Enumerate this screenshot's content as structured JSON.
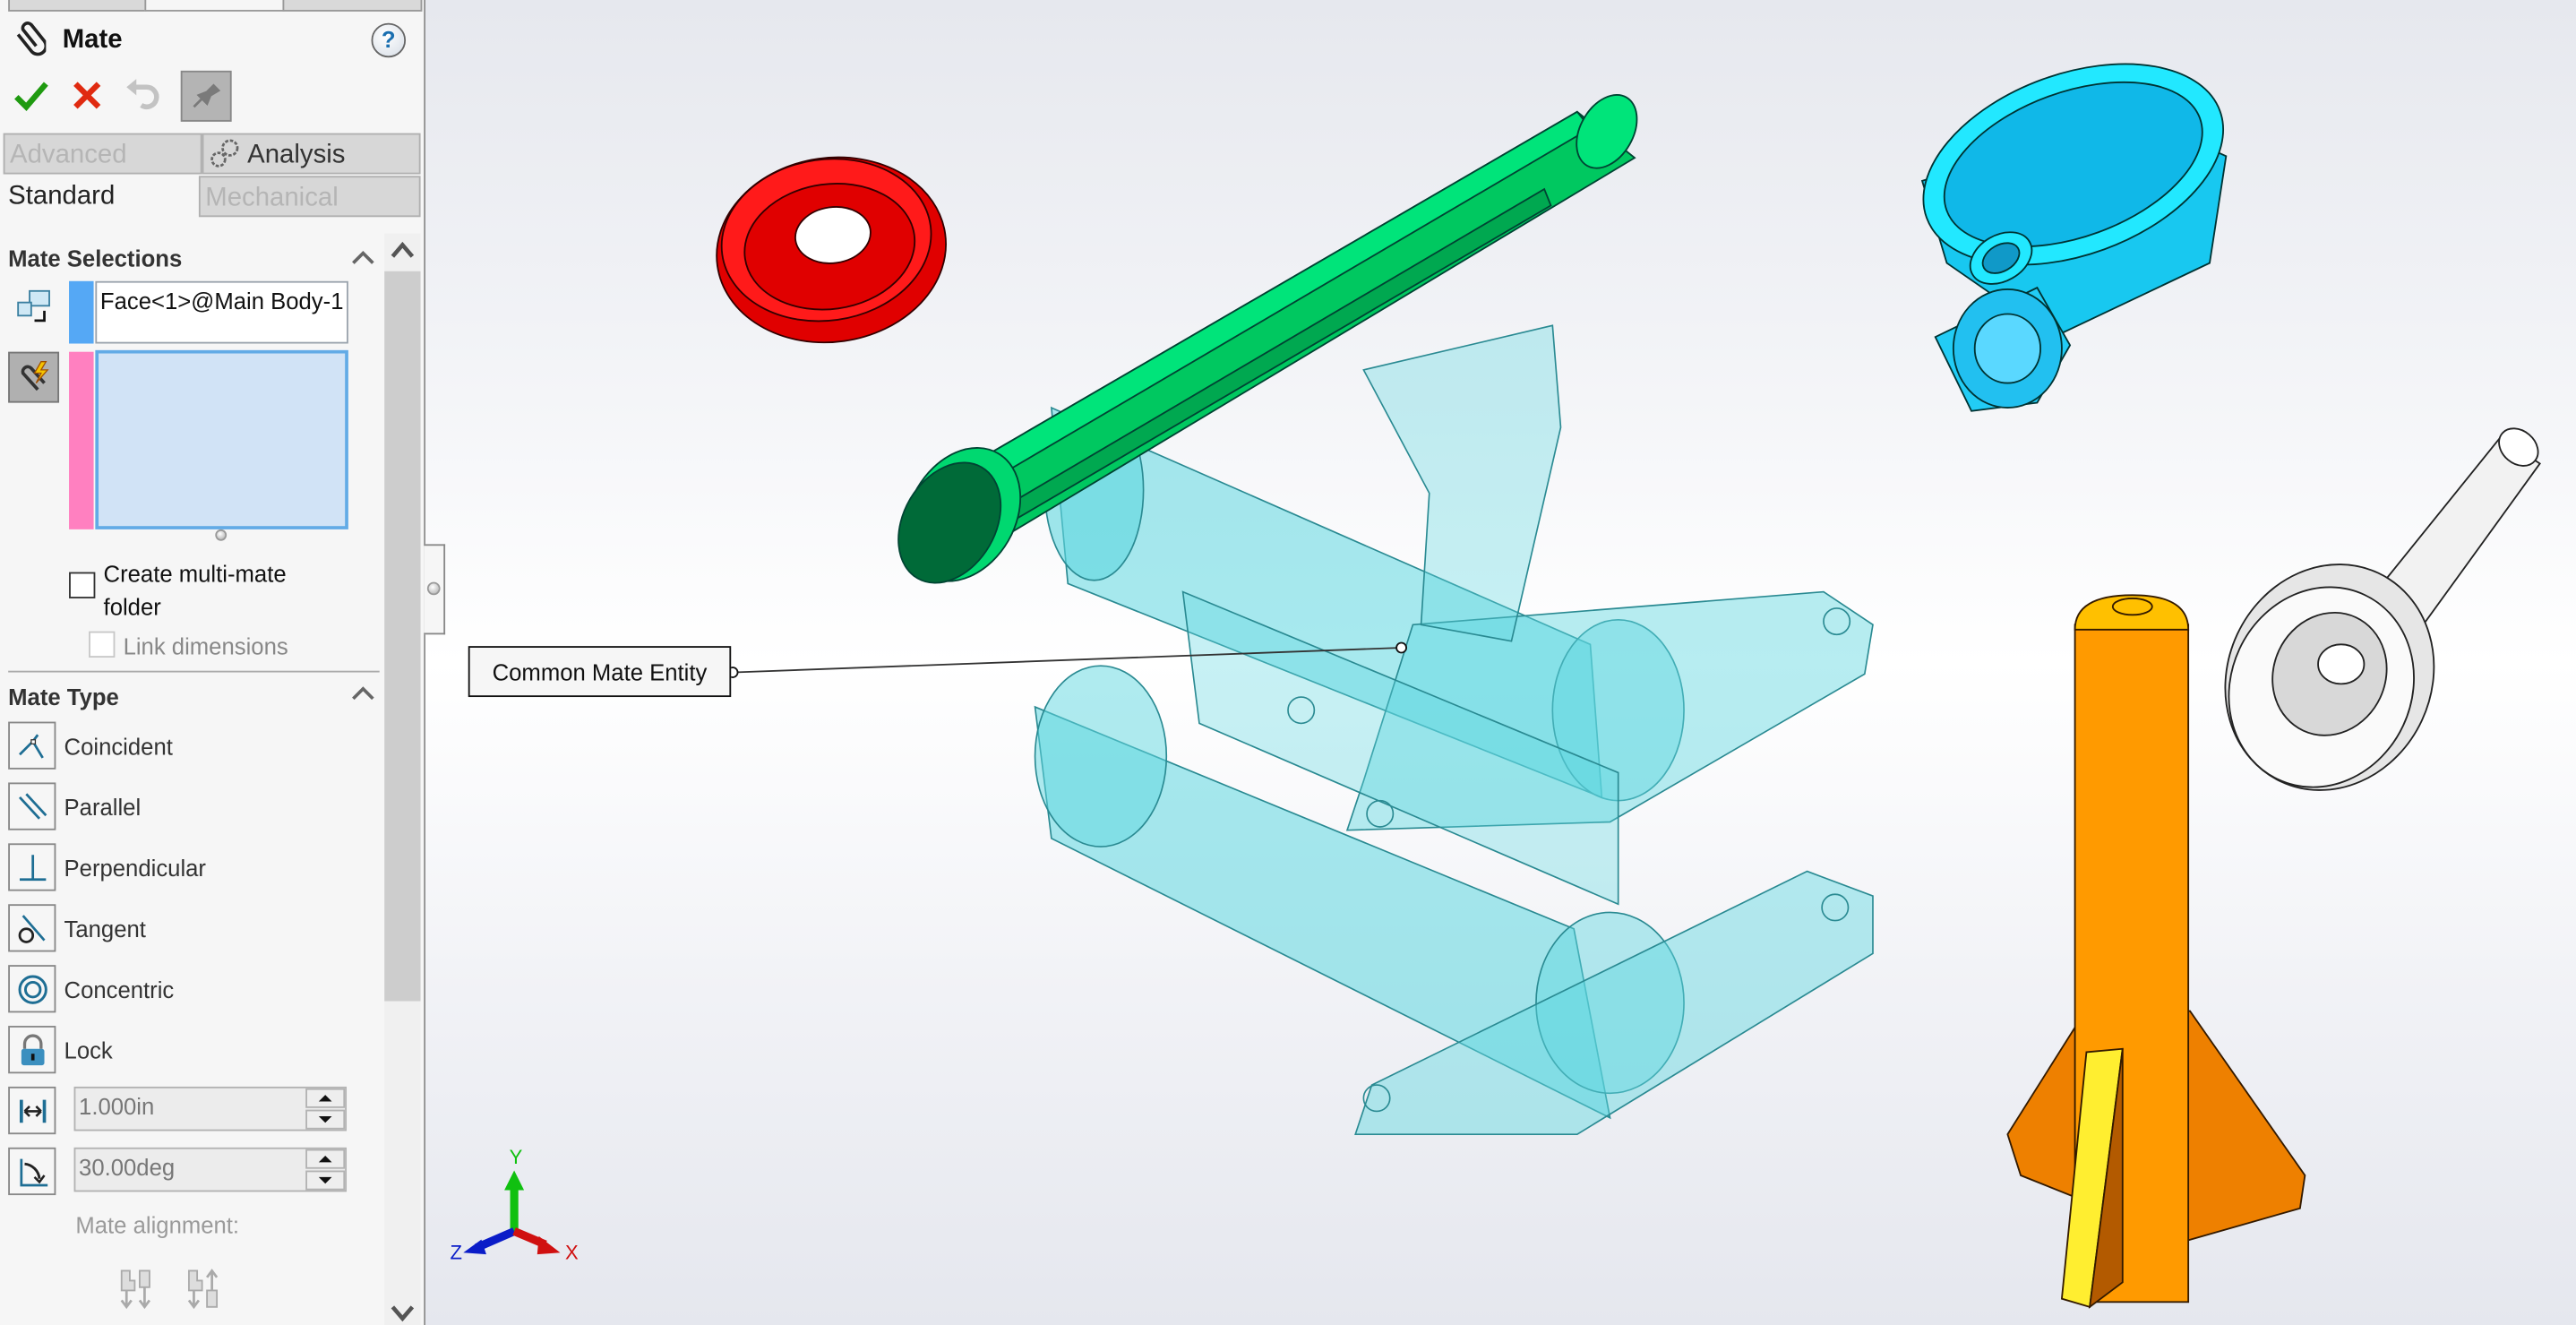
{
  "property_manager": {
    "title": "Mate",
    "help_label": "?",
    "actions": {
      "ok_icon": "checkmark-icon",
      "cancel_icon": "close-icon",
      "undo_icon": "undo-icon",
      "pin_icon": "pushpin-icon"
    },
    "tabs": [
      {
        "label": "Advanced",
        "state": "disabled"
      },
      {
        "label": "Analysis",
        "state": "normal",
        "icon": "gears-icon"
      },
      {
        "label": "Standard",
        "state": "active"
      },
      {
        "label": "Mechanical",
        "state": "disabled"
      }
    ],
    "mate_selections": {
      "header": "Mate Selections",
      "first_selection": "Face<1>@Main Body-1",
      "second_selection": "",
      "first_color": "#55a8f5",
      "second_color": "#ff80c0"
    },
    "create_multimate_folder": {
      "label": "Create multi-mate folder",
      "checked": false
    },
    "link_dimensions": {
      "label": "Link dimensions",
      "checked": false,
      "enabled": false
    },
    "mate_type": {
      "header": "Mate Type",
      "items": [
        {
          "label": "Coincident",
          "icon": "coincident-icon"
        },
        {
          "label": "Parallel",
          "icon": "parallel-icon"
        },
        {
          "label": "Perpendicular",
          "icon": "perpendicular-icon"
        },
        {
          "label": "Tangent",
          "icon": "tangent-icon"
        },
        {
          "label": "Concentric",
          "icon": "concentric-icon"
        },
        {
          "label": "Lock",
          "icon": "lock-icon"
        }
      ],
      "distance_value": "1.000in",
      "angle_value": "30.00deg",
      "mate_alignment_label": "Mate alignment:"
    }
  },
  "viewport": {
    "callout_text": "Common Mate Entity",
    "triad": {
      "x_label": "X",
      "y_label": "Y",
      "z_label": "Z"
    },
    "parts": [
      {
        "name": "red washer",
        "color": "#ff0000"
      },
      {
        "name": "green shaft",
        "color": "#00d870"
      },
      {
        "name": "main body (transparent)",
        "color": "#5fd7e0"
      },
      {
        "name": "cyan clamp",
        "color": "#22ecff"
      },
      {
        "name": "white plunger",
        "color": "#ffffff"
      },
      {
        "name": "orange rocket",
        "color": "#ff9a00"
      },
      {
        "name": "yellow fin",
        "color": "#ffff30"
      }
    ]
  }
}
